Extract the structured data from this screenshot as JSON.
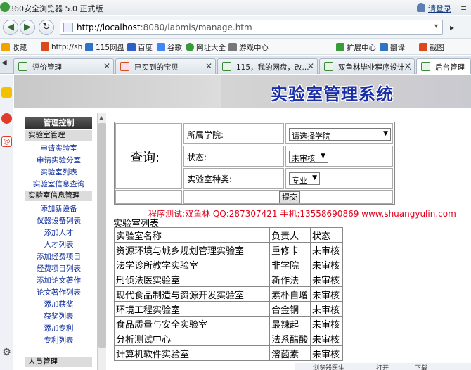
{
  "browser": {
    "title": "360安全浏览器 5.0 正式版",
    "login": "请登录",
    "url_host": "http://localhost",
    "url_rest": ":8080/labmis/manage.htm"
  },
  "favorites": [
    {
      "label": "收藏",
      "color": "#f2a200"
    },
    {
      "label": "http://sh",
      "color": "#d94b1a"
    },
    {
      "label": "115网盘",
      "color": "#2f74c4"
    },
    {
      "label": "百度",
      "color": "#2f5fc4"
    },
    {
      "label": "谷歌",
      "color": "#4285f4"
    },
    {
      "label": "网址大全",
      "color": "#3a9b3a"
    },
    {
      "label": "游戏中心",
      "color": "#777777"
    },
    {
      "label": "扩展中心",
      "color": "#3a9b3a"
    },
    {
      "label": "翻译",
      "color": "#2f74c4"
    },
    {
      "label": "截图",
      "color": "#d94b1a"
    }
  ],
  "tabs": [
    {
      "label": "评价管理"
    },
    {
      "label": "已买到的宝贝"
    },
    {
      "label": "115，我的网盘，改..."
    },
    {
      "label": "双鱼林毕业程序设计..."
    },
    {
      "label": "后台管理"
    }
  ],
  "banner": {
    "title": "实验室管理系统"
  },
  "menu": {
    "header": "管理控制",
    "group1": "实验室管理",
    "group1_items": [
      "申请实验室",
      "申请实验分室",
      "实验室列表",
      "实验室信息查询"
    ],
    "group2": "实验室信息管理",
    "group2_items": [
      "添加新设备",
      "仪器设备列表",
      "添加人才",
      "人才列表",
      "添加经费项目",
      "经费项目列表",
      "添加论文著作",
      "论文著作列表",
      "添加获奖",
      "获奖列表",
      "添加专利",
      "专利列表"
    ],
    "group3": "人员管理"
  },
  "query": {
    "label": "查询:",
    "college_label": "所属学院:",
    "college_value": "请选择学院",
    "status_label": "状态:",
    "status_value": "未审核",
    "type_label": "实验室种类:",
    "type_value": "专业",
    "submit": "提交"
  },
  "tester": "程序测试:双鱼林 QQ:287307421 手机:13558690869 www.shuangyulin.com",
  "list": {
    "title": "实验室列表",
    "headers": [
      "实验室名称",
      "负责人",
      "状态"
    ],
    "rows": [
      [
        "资源环境与城乡规划管理实验室",
        "重修卡",
        "未审核"
      ],
      [
        "法学诊所教学实验室",
        "非学院",
        "未审核"
      ],
      [
        "刑侦法医实验室",
        "新作法",
        "未审核"
      ],
      [
        "现代食品制造与资源开发实验室",
        "素朴自增",
        "未审核"
      ],
      [
        "环境工程实验室",
        "合金钢",
        "未审核"
      ],
      [
        "食品质量与安全实验室",
        "最辣起",
        "未审核"
      ],
      [
        "分析测试中心",
        "法系醋酸",
        "未审核"
      ],
      [
        "计算机软件实验室",
        "溶菌素",
        "未审核"
      ]
    ]
  },
  "statusbar": {
    "items": [
      "浏览器医生",
      "打开",
      "下载"
    ]
  }
}
